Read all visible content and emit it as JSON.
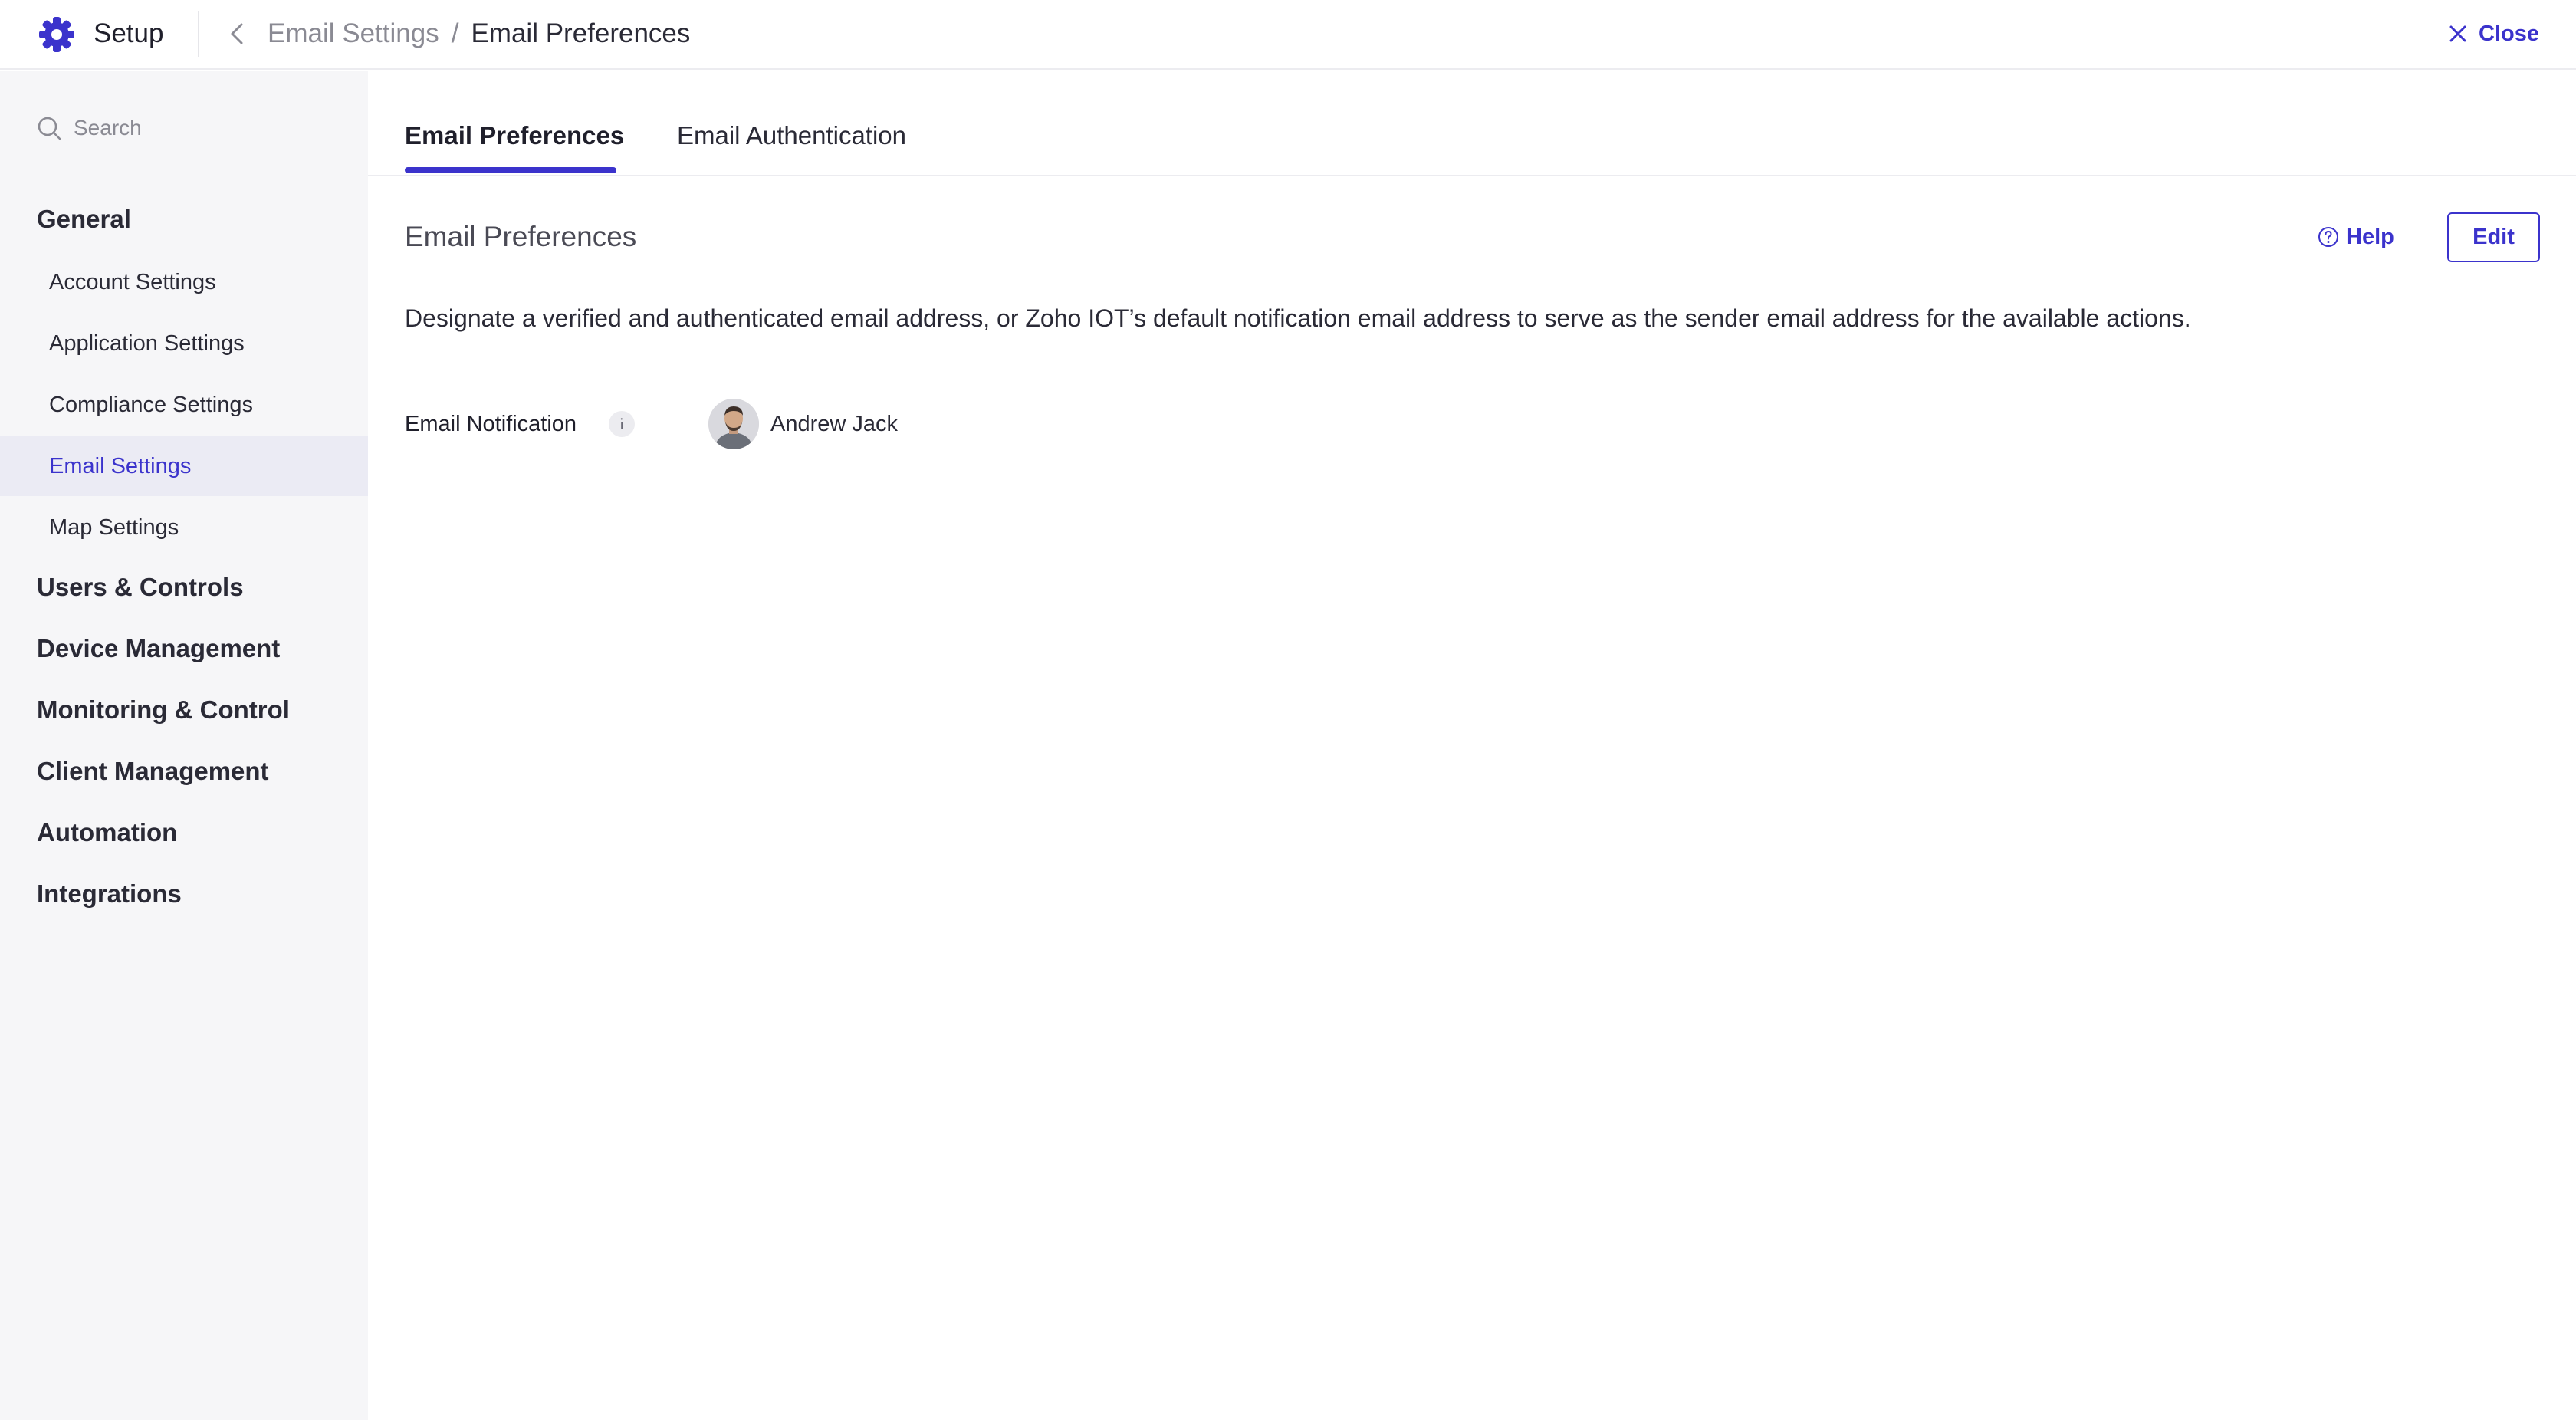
{
  "app": {
    "title": "Setup",
    "logo_icon": "gear-icon",
    "accent_color": "#3b33cc"
  },
  "breadcrumb": {
    "parent": "Email Settings",
    "separator": "/",
    "current": "Email Preferences"
  },
  "topbar": {
    "close_label": "Close"
  },
  "sidebar": {
    "search_placeholder": "Search",
    "general_label": "General",
    "items": [
      {
        "label": "Account Settings"
      },
      {
        "label": "Application Settings"
      },
      {
        "label": "Compliance Settings"
      },
      {
        "label": "Email Settings",
        "active": true
      },
      {
        "label": "Map Settings"
      }
    ],
    "sections": [
      {
        "label": "Users & Controls"
      },
      {
        "label": "Device Management"
      },
      {
        "label": "Monitoring & Control"
      },
      {
        "label": "Client Management"
      },
      {
        "label": "Automation"
      },
      {
        "label": "Integrations"
      }
    ]
  },
  "tabs": [
    {
      "label": "Email Preferences",
      "active": true
    },
    {
      "label": "Email Authentication"
    }
  ],
  "content": {
    "section_title": "Email Preferences",
    "help_label": "Help",
    "edit_label": "Edit",
    "description": "Designate a verified and authenticated email address, or Zoho IOT’s default notification email address to serve as the sender email address for the available actions.",
    "field_label": "Email Notification",
    "info_glyph": "i",
    "user_name": "Andrew Jack"
  }
}
